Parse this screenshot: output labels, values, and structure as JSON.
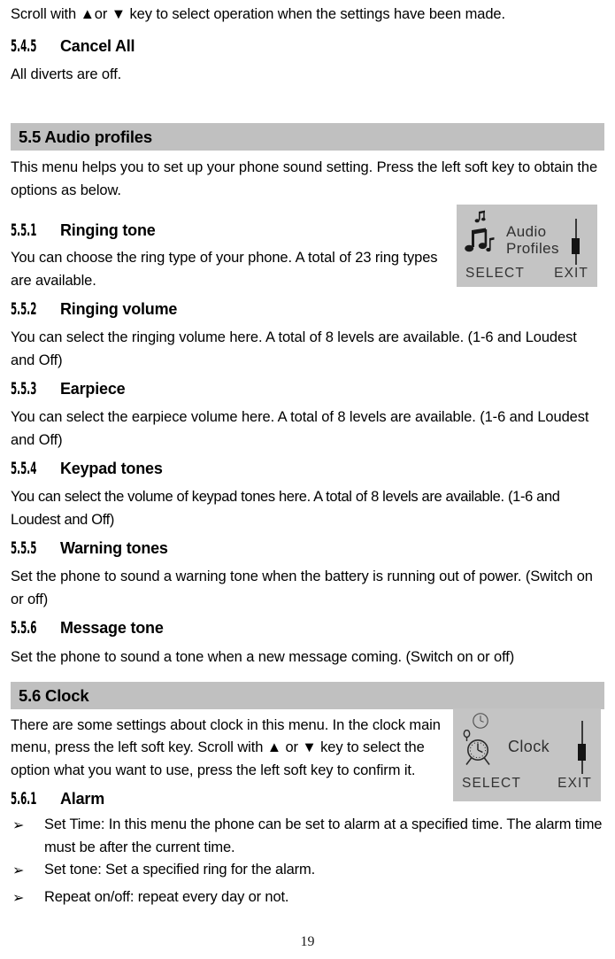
{
  "page": {
    "number": "19"
  },
  "intro": {
    "scroll_line": "Scroll with ▲or ▼ key to select operation when the settings have been made."
  },
  "section_545": {
    "number": "5.4.5",
    "title": "Cancel All",
    "body": "All diverts are off."
  },
  "section_55": {
    "bar_title": "5.5 Audio profiles",
    "intro": "This menu helps you to set up your phone sound setting. Press the left soft key to obtain the options as below.",
    "subsections": [
      {
        "number": "5.5.1",
        "title": "Ringing tone",
        "body": "You can choose the ring type of your phone. A total of 23 ring types are available."
      },
      {
        "number": "5.5.2",
        "title": "Ringing volume",
        "body": "You can select the ringing volume here. A total of 8 levels are available. (1-6 and Loudest and Off)"
      },
      {
        "number": "5.5.3",
        "title": "Earpiece",
        "body": "You can select the earpiece volume here. A total of 8 levels are available. (1-6 and Loudest and Off)"
      },
      {
        "number": "5.5.4",
        "title": "Keypad tones",
        "body": "You can select the volume of keypad tones here. A total of 8 levels are available. (1-6 and Loudest and Off)"
      },
      {
        "number": "5.5.5",
        "title": "Warning tones",
        "body": "Set the phone to sound a warning tone when the battery is running out of power. (Switch on or off)"
      },
      {
        "number": "5.5.6",
        "title": "Message tone",
        "body": "Set the phone to sound a tone when a new message coming. (Switch on or off)"
      }
    ]
  },
  "section_56": {
    "bar_title": "5.6 Clock",
    "intro": "There are some settings about clock in this menu. In the clock main menu, press the left soft key. Scroll with ▲ or ▼ key to select the option what you want to use, press the left soft key to confirm it.",
    "subsection": {
      "number": "5.6.1",
      "title": "Alarm"
    },
    "bullets": [
      {
        "glyph": "➢",
        "text": "Set Time: In this menu the phone can be set to alarm at a specified time. The alarm time must be after the current time."
      },
      {
        "glyph": "➢",
        "text": "Set tone: Set a specified ring for the alarm."
      },
      {
        "glyph": "➢",
        "text": "Repeat on/off: repeat every day or not."
      }
    ]
  },
  "audio_panel": {
    "label_line1": "Audio",
    "label_line2": "Profiles",
    "left_softkey": "SELECT",
    "right_softkey": "EXIT",
    "icon_top": "music-note-icon",
    "icon_main": "music-notes-icon",
    "background_color": "#c4c4c4"
  },
  "clock_panel": {
    "label": "Clock",
    "left_softkey": "SELECT",
    "right_softkey": "EXIT",
    "icon_top": "clock-icon",
    "icon_main": "alarm-clock-icon",
    "background_color": "#c4c4c4"
  }
}
